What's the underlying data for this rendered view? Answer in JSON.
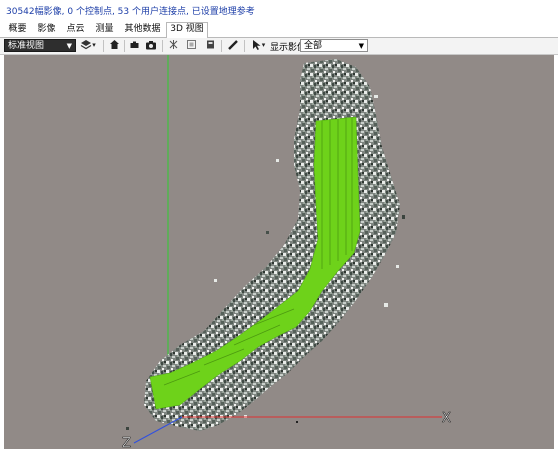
{
  "status": {
    "text": "30542幅影像, 0 个控制点, 53 个用户连接点, 已设置地理参考",
    "color": "#1e3fa8"
  },
  "tabs": [
    {
      "label": "概要"
    },
    {
      "label": "影像"
    },
    {
      "label": "点云"
    },
    {
      "label": "测量"
    },
    {
      "label": "其他数据"
    },
    {
      "label": "3D 视图",
      "active": true
    }
  ],
  "toolbar": {
    "view_select": "标准视图",
    "display_label": "显示影像",
    "display_select": "全部",
    "icons": [
      "layers-icon",
      "home-icon",
      "camera-small-icon",
      "camera-icon",
      "grid-icon",
      "box-icon",
      "panel-icon",
      "ruler-icon",
      "pointer-icon"
    ]
  },
  "viewport": {
    "background": "#918a87",
    "axes": {
      "x_label": "X",
      "z_label": "Z",
      "x_color": "#e03030",
      "y_color": "#2fcf2f",
      "z_color": "#3050e0"
    },
    "flight_lines_color": "#6ed21a"
  }
}
